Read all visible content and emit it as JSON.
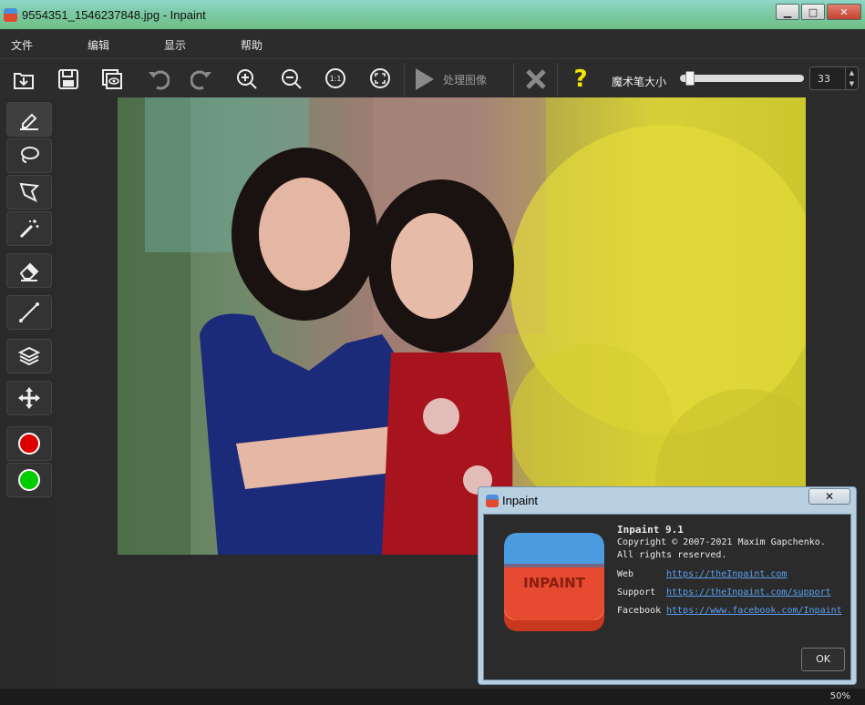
{
  "window": {
    "title": "9554351_1546237848.jpg - Inpaint",
    "buttons": {
      "minimize": "▁",
      "maximize": "□",
      "close": "✕"
    }
  },
  "menu": {
    "items": [
      "文件",
      "编辑",
      "显示",
      "帮助"
    ]
  },
  "toolbar": {
    "process_label": "处理图像",
    "magic_wand_label": "魔术笔大小",
    "brush_size": "33",
    "brush_size_fraction": 0.05,
    "help_glyph": "?",
    "icons": [
      "open-file-icon",
      "save-icon",
      "preview-icon",
      "undo-icon",
      "redo-icon",
      "zoom-in-icon",
      "zoom-out-icon",
      "actual-size-icon",
      "fit-screen-icon",
      "process-icon",
      "clear-icon",
      "help-icon"
    ]
  },
  "tools": {
    "icons": [
      "marker-icon",
      "lasso-icon",
      "polygonal-lasso-icon",
      "magic-wand-icon",
      "eraser-icon",
      "line-tool-icon",
      "layers-icon",
      "move-icon"
    ],
    "colors": {
      "remove": "#dd0000",
      "keep": "#00cc00"
    }
  },
  "status": {
    "zoom": "50%"
  },
  "about": {
    "title": "Inpaint",
    "close_label": "✕",
    "logo_text": "INPAINT",
    "app_name": "Inpaint 9.1",
    "copyright": "Copyright © 2007-2021 Maxim Gapchenko.",
    "rights": "All rights reserved.",
    "links": [
      {
        "label": "Web",
        "url": "https://theInpaint.com"
      },
      {
        "label": "Support",
        "url": "https://theInpaint.com/support"
      },
      {
        "label": "Facebook",
        "url": "https://www.facebook.com/Inpaint"
      }
    ],
    "ok_label": "OK"
  }
}
